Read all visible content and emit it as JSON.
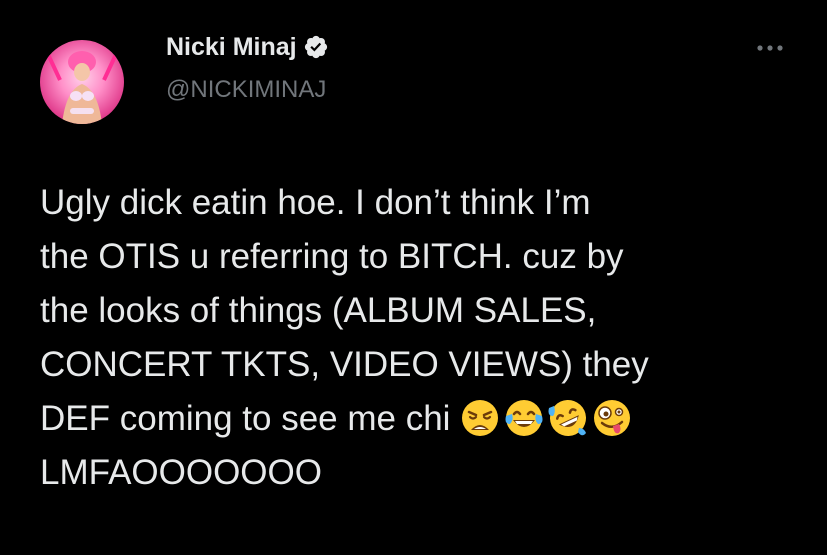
{
  "tweet": {
    "author": {
      "display_name": "Nicki Minaj",
      "handle": "@NICKIMINAJ",
      "verified": true,
      "avatar_icon": "profile-photo"
    },
    "more_icon": "ellipsis-icon",
    "text_lines": [
      "Ugly dick eatin hoe. I don’t think I’m",
      "the OTIS u referring to BITCH. cuz by",
      "the looks of things (ALBUM SALES,",
      "CONCERT TKTS, VIDEO VIEWS) they",
      "DEF coming to see me chi",
      "LMFAOOOOOOO"
    ],
    "emojis": [
      "weary-face",
      "face-with-tears-of-joy",
      "rolling-on-the-floor-laughing",
      "zany-face"
    ]
  },
  "colors": {
    "background": "#000000",
    "text": "#e7e9ea",
    "secondary_text": "#71767b",
    "verified_badge": "#e7e9ea",
    "emoji_yellow": "#ffcc33",
    "emoji_tear": "#4fb3f6"
  }
}
